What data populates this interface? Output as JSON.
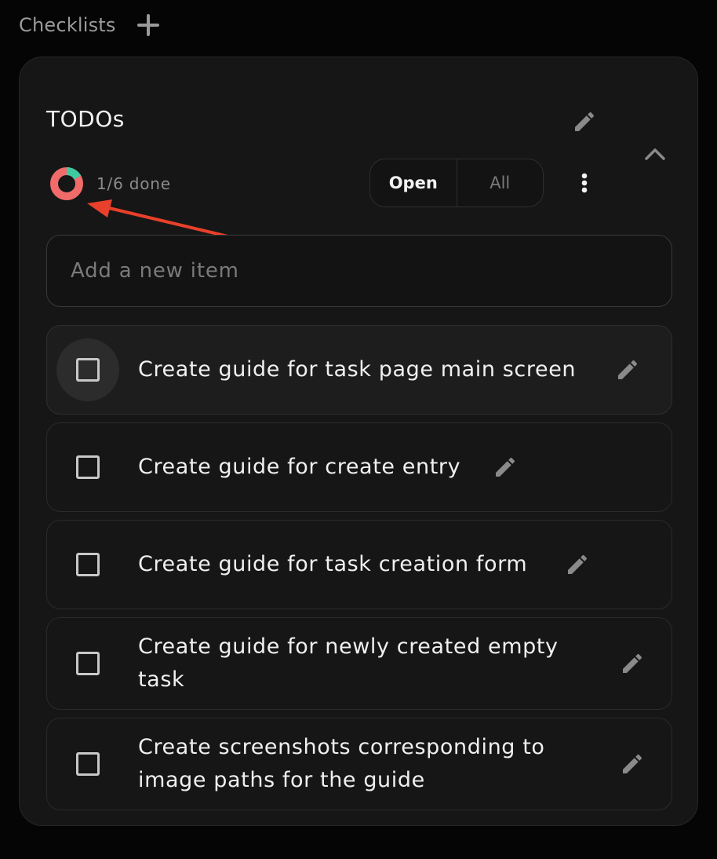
{
  "header": {
    "title": "Checklists",
    "add_icon": "plus-icon"
  },
  "checklist": {
    "title": "TODOs",
    "progress": {
      "done": 1,
      "total": 6,
      "text": "1/6 done",
      "done_color": "#3ec9a0",
      "remaining_color": "#f26b6b"
    },
    "filters": {
      "open_label": "Open",
      "all_label": "All",
      "selected": "Open"
    },
    "new_item_placeholder": "Add a new item",
    "items": [
      {
        "text": "Create guide for task page main screen",
        "checked": false
      },
      {
        "text": "Create guide for create entry",
        "checked": false
      },
      {
        "text": "Create guide for task creation form",
        "checked": false
      },
      {
        "text": "Create guide for newly created empty task",
        "checked": false
      },
      {
        "text": "Create screenshots corresponding to image paths for the guide",
        "checked": false
      }
    ]
  },
  "annotation": {
    "color": "#e8402a",
    "icon": "arrow-annotation"
  }
}
